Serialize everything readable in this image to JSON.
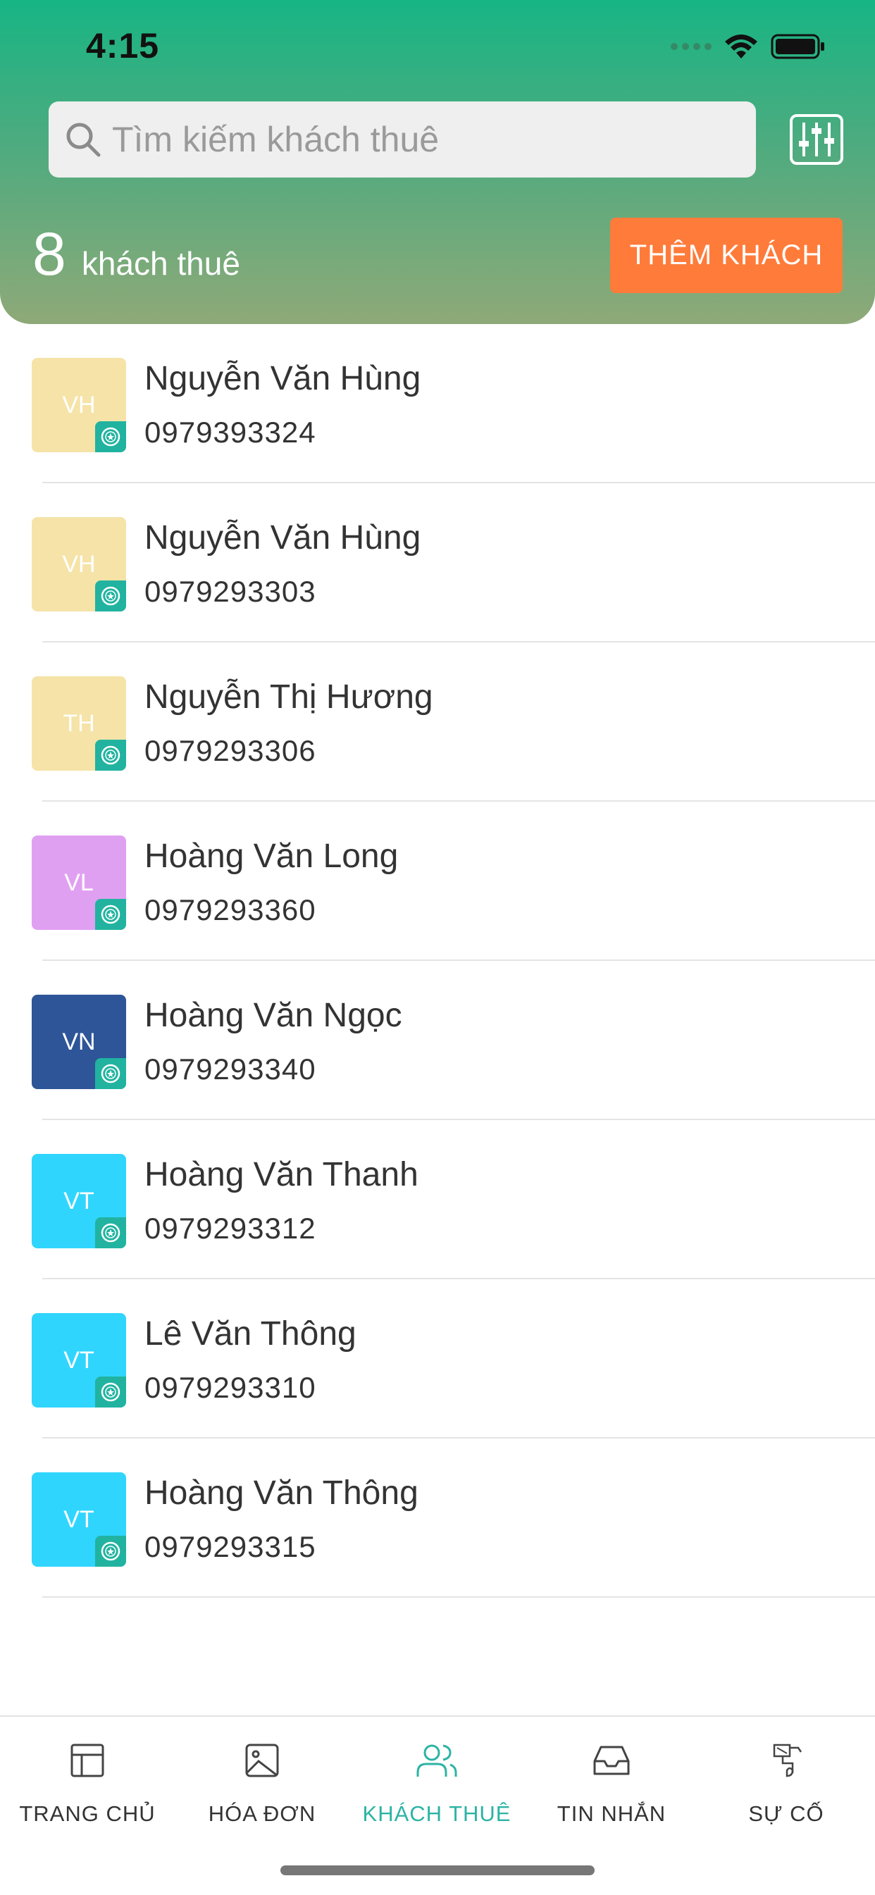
{
  "status_bar": {
    "time": "4:15"
  },
  "search": {
    "placeholder": "Tìm kiếm khách thuê",
    "icon": "search-icon"
  },
  "filter": {
    "icon": "sliders-icon"
  },
  "summary": {
    "count": "8",
    "label": "khách thuê"
  },
  "add_button": {
    "label": "THÊM KHÁCH"
  },
  "colors": {
    "accent": "#17b584",
    "orange": "#ff7b3a",
    "badge": "#21b3a0",
    "active_tab": "#2cb3a4"
  },
  "tenants": [
    {
      "initials": "VH",
      "name": "Nguyễn Văn Hùng",
      "phone": "0979393324",
      "color": "#f5e3a8"
    },
    {
      "initials": "VH",
      "name": "Nguyễn Văn Hùng",
      "phone": "0979293303",
      "color": "#f5e3a8"
    },
    {
      "initials": "TH",
      "name": "Nguyễn Thị Hương",
      "phone": "0979293306",
      "color": "#f5e3a8"
    },
    {
      "initials": "VL",
      "name": "Hoàng Văn Long",
      "phone": "0979293360",
      "color": "#e0a0f2"
    },
    {
      "initials": "VN",
      "name": "Hoàng Văn Ngọc",
      "phone": "0979293340",
      "color": "#2d5597"
    },
    {
      "initials": "VT",
      "name": "Hoàng Văn Thanh",
      "phone": "0979293312",
      "color": "#30d5fd"
    },
    {
      "initials": "VT",
      "name": "Lê Văn Thông",
      "phone": "0979293310",
      "color": "#30d5fd"
    },
    {
      "initials": "VT",
      "name": "Hoàng Văn Thông",
      "phone": "0979293315",
      "color": "#30d5fd"
    }
  ],
  "tabs": [
    {
      "label": "TRANG CHỦ",
      "icon": "layout-icon",
      "active": false
    },
    {
      "label": "HÓA ĐƠN",
      "icon": "image-icon",
      "active": false
    },
    {
      "label": "KHÁCH THUÊ",
      "icon": "users-icon",
      "active": true
    },
    {
      "label": "TIN NHẮN",
      "icon": "inbox-icon",
      "active": false
    },
    {
      "label": "SỰ CỐ",
      "icon": "tool-icon",
      "active": false
    }
  ]
}
